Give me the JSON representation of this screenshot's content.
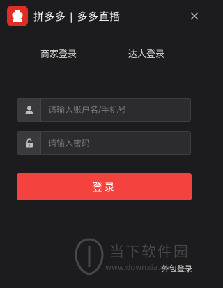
{
  "window": {
    "title": "拼多多 | 多多直播",
    "logo_text": "拼多多"
  },
  "tabs": [
    {
      "label": "商家登录"
    },
    {
      "label": "达人登录"
    }
  ],
  "form": {
    "username_placeholder": "请输入账户名/手机号",
    "password_placeholder": "请输入密码",
    "login_label": "登录"
  },
  "footer": {
    "outsource_login": "外包登录"
  },
  "watermark": {
    "cn": "当下软件园",
    "url": "www.downxia.com"
  },
  "colors": {
    "background": "#1c1c1e",
    "accent": "#f4433f",
    "logo": "#e02e24"
  }
}
